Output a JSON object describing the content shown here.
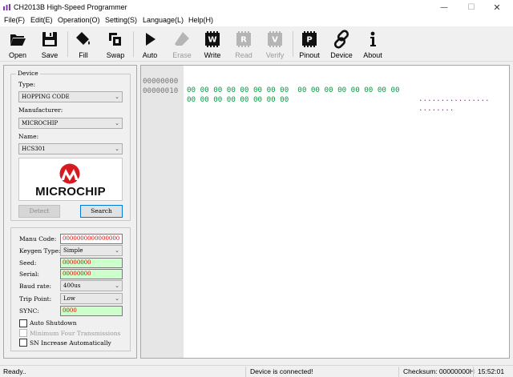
{
  "window": {
    "title": "CH2013B High-Speed Programmer",
    "minimize_glyph": "—",
    "maximize_glyph": "☐",
    "close_glyph": "✕"
  },
  "menu": {
    "items": [
      {
        "label": "File(F)"
      },
      {
        "label": "Edit(E)"
      },
      {
        "label": "Operation(O)"
      },
      {
        "label": "Setting(S)"
      },
      {
        "label": "Language(L)"
      },
      {
        "label": "Help(H)"
      }
    ]
  },
  "toolbar": {
    "items": [
      {
        "label": "Open",
        "icon": "open-folder-icon",
        "enabled": true
      },
      {
        "label": "Save",
        "icon": "save-disk-icon",
        "enabled": true
      },
      {
        "label": "Fill",
        "icon": "fill-bucket-icon",
        "enabled": true
      },
      {
        "label": "Swap",
        "icon": "swap-icon",
        "enabled": true
      },
      {
        "label": "Auto",
        "icon": "play-icon",
        "enabled": true
      },
      {
        "label": "Erase",
        "icon": "eraser-icon",
        "enabled": false
      },
      {
        "label": "Write",
        "icon": "chip-w-icon",
        "enabled": true
      },
      {
        "label": "Read",
        "icon": "chip-r-icon",
        "enabled": false
      },
      {
        "label": "Verify",
        "icon": "chip-v-icon",
        "enabled": false
      },
      {
        "label": "Pinout",
        "icon": "chip-p-icon",
        "enabled": true
      },
      {
        "label": "Device",
        "icon": "link-icon",
        "enabled": true
      },
      {
        "label": "About",
        "icon": "info-icon",
        "enabled": true
      }
    ],
    "chip_letters": {
      "write": "W",
      "read": "R",
      "verify": "V",
      "pinout": "P"
    }
  },
  "device": {
    "group_title": "Device",
    "type_label": "Type:",
    "type_value": "HOPPING CODE",
    "manufacturer_label": "Manufacturer:",
    "manufacturer_value": "MICROCHIP",
    "name_label": "Name:",
    "name_value": "HCS301",
    "logo_text": "MICROCHIP",
    "detect_label": "Detect",
    "search_label": "Search"
  },
  "settings": {
    "manu_code_label": "Manu Code:",
    "manu_code_value": "0000000000000000",
    "keygen_type_label": "Keygen Type:",
    "keygen_type_value": "Simple",
    "seed_label": "Seed:",
    "seed_value": "00000000",
    "serial_label": "Serial:",
    "serial_value": "00000000",
    "baud_rate_label": "Baud rate:",
    "baud_rate_value": "400us",
    "trip_point_label": "Trip Point:",
    "trip_point_value": "Low",
    "sync_label": "SYNC:",
    "sync_value": "0000",
    "auto_shutdown_label": "Auto Shutdown",
    "auto_shutdown_checked": false,
    "min_four_label": "Minimum Four Transmissions",
    "min_four_enabled": false,
    "sn_increase_label": "SN Increase Automatically",
    "sn_increase_checked": false
  },
  "hex": {
    "rows": [
      {
        "address": "00000000",
        "bytes": "00 00 00 00 00 00 00 00  00 00 00 00 00 00 00 00",
        "ascii": "................"
      },
      {
        "address": "00000010",
        "bytes": "00 00 00 00 00 00 00 00",
        "ascii": "........"
      }
    ],
    "colors": {
      "address": "#777777",
      "bytes": "#00a040",
      "ascii": "#c000c0"
    }
  },
  "status": {
    "left": "Ready..",
    "center": "Device is connected!",
    "checksum": "Checksum: 00000000H",
    "time": "15:52:01"
  },
  "colors": {
    "error_text": "#e00000",
    "field_green": "#ccffcc",
    "microchip_red": "#d71920",
    "focus_blue": "#0078d7"
  }
}
